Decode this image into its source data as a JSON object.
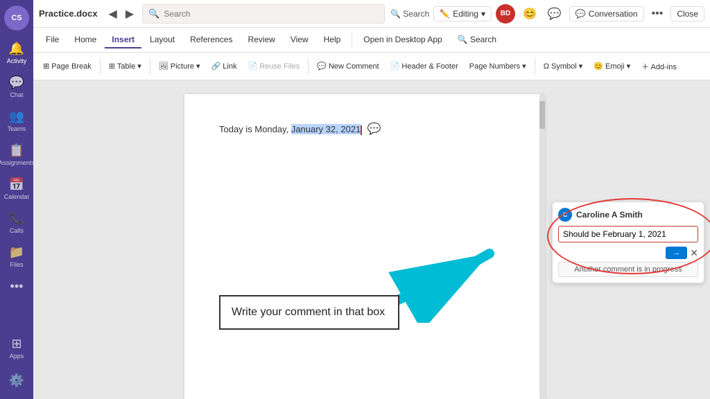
{
  "app": {
    "title": "Practice.docx"
  },
  "topbar": {
    "back_icon": "◀",
    "forward_icon": "▶",
    "search_placeholder": "Search",
    "editing_label": "Editing",
    "editing_icon": "✏️",
    "more_icon": "•••",
    "close_label": "Close",
    "conversation_label": "Conversation",
    "conversation_icon": "💬",
    "search_icon": "🔍",
    "user_initials": "BD"
  },
  "ribbon": {
    "tabs": [
      "File",
      "Home",
      "Insert",
      "Layout",
      "References",
      "Review",
      "View",
      "Help",
      "Open in Desktop App",
      "Search"
    ]
  },
  "ribbon_active_tab": "Insert",
  "toolbar": {
    "items": [
      {
        "label": "Page Break",
        "icon": "⊞"
      },
      {
        "label": "Table ▾",
        "icon": "⊞"
      },
      {
        "label": "Picture ▾",
        "icon": "🖼"
      },
      {
        "label": "Link",
        "icon": "🔗"
      },
      {
        "label": "Reuse Files",
        "icon": "📄"
      },
      {
        "label": "New Comment",
        "icon": "💬"
      },
      {
        "label": "Header & Footer",
        "icon": "📄"
      },
      {
        "label": "Page Numbers ▾",
        "icon": "#"
      },
      {
        "label": "Symbol ▾",
        "icon": "Ω"
      },
      {
        "label": "Emoji ▾",
        "icon": "😊"
      },
      {
        "label": "Add-ins",
        "icon": "＋"
      }
    ]
  },
  "doc": {
    "text_before": "Today is Monday, ",
    "text_highlighted": "January 32, 2021",
    "text_after": ""
  },
  "comment": {
    "user_name": "Caroline A Smith",
    "user_initials": "C",
    "input_value": "Should be February 1, 2021",
    "progress_text": "Another comment is in progress",
    "send_label": "→",
    "cancel_label": "✕"
  },
  "annotation": {
    "text": "Write your comment in that box"
  },
  "sidebar": {
    "items": [
      {
        "label": "Activity",
        "icon": "🔔"
      },
      {
        "label": "Chat",
        "icon": "💬"
      },
      {
        "label": "Teams",
        "icon": "👥"
      },
      {
        "label": "Assignments",
        "icon": "📋"
      },
      {
        "label": "Calendar",
        "icon": "📅"
      },
      {
        "label": "Calls",
        "icon": "📞"
      },
      {
        "label": "Files",
        "icon": "📁"
      },
      {
        "label": "•••",
        "icon": "•••"
      }
    ],
    "bottom_items": [
      {
        "label": "Apps",
        "icon": "⊞"
      },
      {
        "label": "Settings",
        "icon": "⚙️"
      }
    ]
  }
}
